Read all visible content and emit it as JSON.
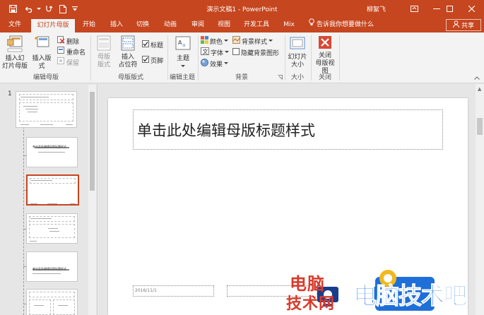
{
  "window": {
    "title": "演示文稿1 - PowerPoint",
    "user": "柳絮飞"
  },
  "tabs": {
    "file": "文件",
    "slide_master": "幻灯片母版",
    "home": "开始",
    "insert": "插入",
    "transitions": "切换",
    "animations": "动画",
    "review": "审阅",
    "view": "视图",
    "developer": "开发工具",
    "mix": "Mix",
    "tell_me": "告诉我你想要做什么",
    "share": "共享"
  },
  "ribbon": {
    "edit_master": {
      "insert_slide_master": "插入幻\n灯片母版",
      "insert_layout": "插入版式",
      "delete": "删除",
      "rename": "重命名",
      "preserve": "保留",
      "group_label": "编辑母版"
    },
    "master_layout": {
      "master_layout_btn": "母版\n版式",
      "insert_placeholder": "插入\n占位符",
      "title_check": "标题",
      "footer_check": "页脚",
      "group_label": "母版版式"
    },
    "edit_theme": {
      "themes": "主题",
      "group_label": "编辑主题"
    },
    "background": {
      "colors": "颜色",
      "fonts": "字体",
      "effects": "效果",
      "background_styles": "背景样式",
      "hide_background_graphics": "隐藏背景图形",
      "group_label": "背景"
    },
    "size": {
      "slide_size": "幻灯片\n大小",
      "group_label": "大小"
    },
    "close": {
      "close_master_view": "关闭\n母版视图",
      "group_label": "关闭"
    }
  },
  "thumbnails": {
    "master_number": "1",
    "layout2_title": "单击此处编辑母版标题样式",
    "layout4_title": "单击此处编辑母版标题样式"
  },
  "slide": {
    "title_placeholder": "单击此处编辑母版标题样式",
    "date_placeholder": "2016/11/1"
  },
  "watermark": {
    "line1": "电脑",
    "line2": "技术网",
    "brand": "电脑技术吧"
  },
  "colors": {
    "accent": "#c5461f",
    "watermark_red": "#d93a2b",
    "watermark_blue": "#1e6fd8"
  }
}
